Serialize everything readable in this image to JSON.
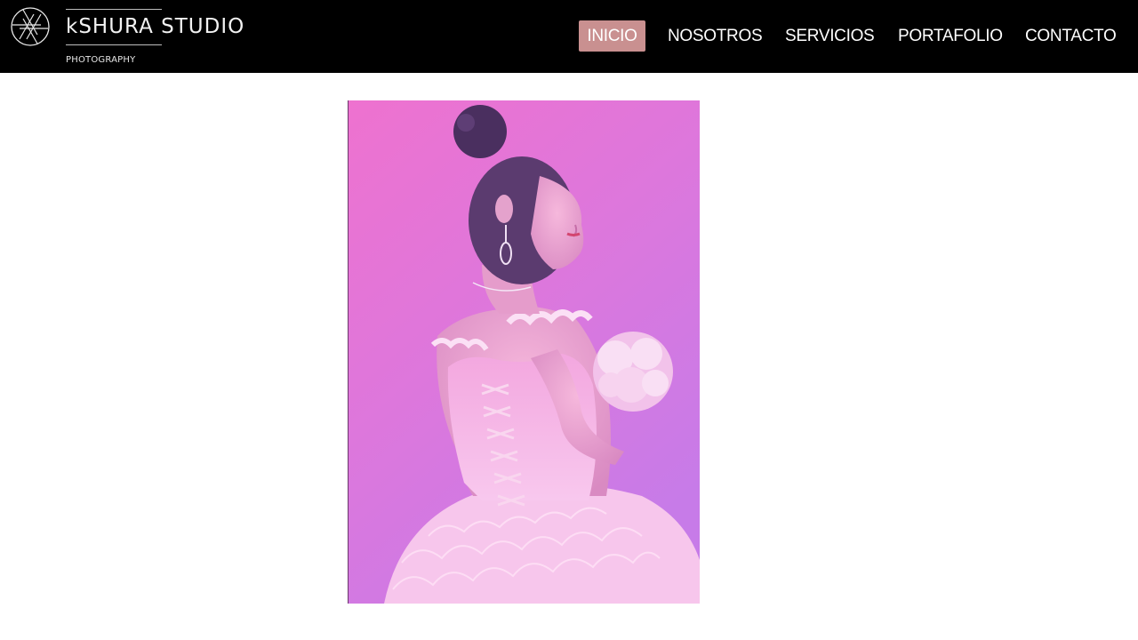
{
  "brand": {
    "name": "kSHURA STUDIO",
    "tagline": "PHOTOGRAPHY",
    "icon": "camera-aperture-icon"
  },
  "nav": {
    "items": [
      {
        "label": "INICIO",
        "active": true
      },
      {
        "label": "NOSOTROS",
        "active": false
      },
      {
        "label": "SERVICIOS",
        "active": false
      },
      {
        "label": "PORTAFOLIO",
        "active": false
      },
      {
        "label": "CONTACTO",
        "active": false
      }
    ]
  },
  "colors": {
    "header_bg": "#000000",
    "active_nav_bg": "#c99090",
    "nav_text": "#ffffff",
    "page_bg": "#ffffff",
    "photo_bg_top": "#ee72cf",
    "photo_bg_bottom": "#c77be8",
    "dress": "#f4b2e6"
  },
  "hero": {
    "subject": "girl in pink ball gown with bouquet"
  }
}
